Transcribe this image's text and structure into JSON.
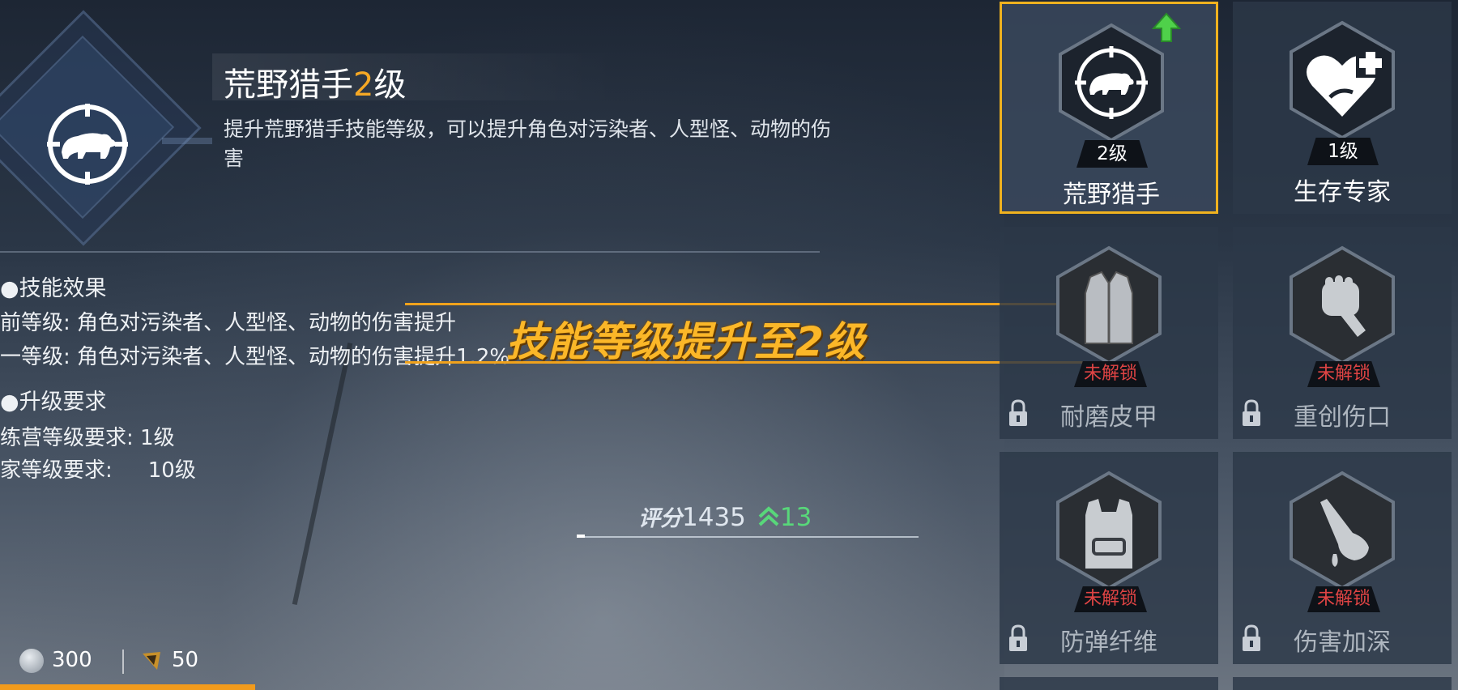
{
  "skill": {
    "name": "荒野猎手",
    "level_num": "2",
    "level_suffix": "级",
    "description": "提升荒野猎手技能等级，可以提升角色对污染者、人型怪、动物的伤害"
  },
  "effects": {
    "header": "技能效果",
    "current": "前等级: 角色对污染者、人型怪、动物的伤害提升",
    "next": "一等级: 角色对污染者、人型怪、动物的伤害提升1.2%"
  },
  "requirements": {
    "header": "升级要求",
    "camp": "练营等级要求: 1级",
    "player_label": "家等级要求:",
    "player_value": "10级"
  },
  "banner": "技能等级提升至2级",
  "score": {
    "label": "评分",
    "value": "1435",
    "increase": "13"
  },
  "currency": {
    "coins": "300",
    "gems": "50"
  },
  "skills_grid": [
    {
      "name": "荒野猎手",
      "level": "2级",
      "locked": false,
      "selected": true,
      "icon": "bear-crosshair-icon"
    },
    {
      "name": "生存专家",
      "level": "1级",
      "locked": false,
      "selected": false,
      "icon": "heart-plus-icon"
    },
    {
      "name": "耐磨皮甲",
      "status": "未解锁",
      "locked": true,
      "icon": "vest-icon"
    },
    {
      "name": "重创伤口",
      "status": "未解锁",
      "locked": true,
      "icon": "fist-icon"
    },
    {
      "name": "防弹纤维",
      "status": "未解锁",
      "locked": true,
      "icon": "armor-plate-icon"
    },
    {
      "name": "伤害加深",
      "status": "未解锁",
      "locked": true,
      "icon": "bleeding-hand-icon"
    }
  ],
  "colors": {
    "accent": "#f0b21f",
    "locked_text": "#e04444",
    "upgrade_green": "#58d77a"
  }
}
